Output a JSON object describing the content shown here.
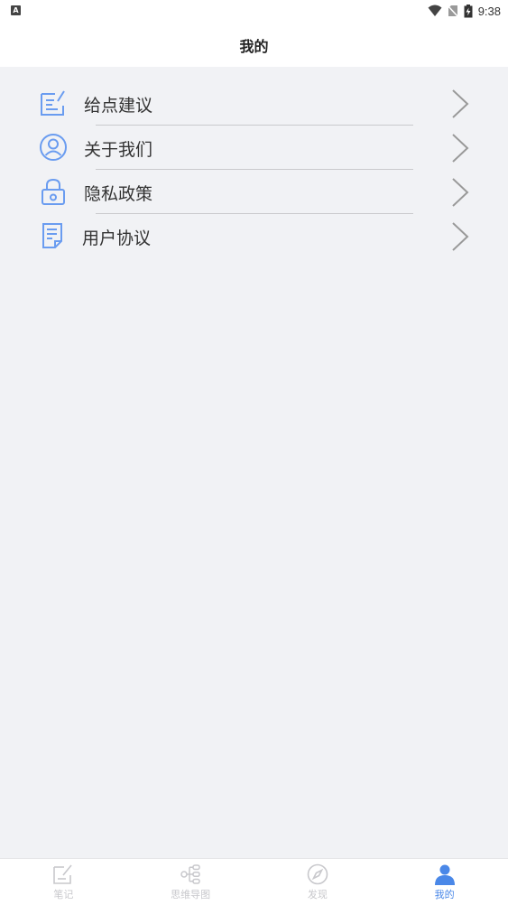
{
  "status_bar": {
    "left_badge": "A",
    "time": "9:38"
  },
  "header": {
    "title": "我的"
  },
  "menu": {
    "items": [
      {
        "label": "给点建议",
        "icon": "edit-note-icon"
      },
      {
        "label": "关于我们",
        "icon": "user-circle-icon"
      },
      {
        "label": "隐私政策",
        "icon": "lock-icon"
      },
      {
        "label": "用户协议",
        "icon": "document-icon"
      }
    ]
  },
  "bottom_nav": {
    "tabs": [
      {
        "label": "笔记",
        "icon": "note-icon",
        "active": false
      },
      {
        "label": "思维导图",
        "icon": "mindmap-icon",
        "active": false
      },
      {
        "label": "发现",
        "icon": "compass-icon",
        "active": false
      },
      {
        "label": "我的",
        "icon": "person-icon",
        "active": true
      }
    ]
  },
  "colors": {
    "accent": "#4a88e8",
    "icon_blue": "#6a9cf0",
    "inactive": "#c8c8cc",
    "background": "#f1f2f5"
  }
}
